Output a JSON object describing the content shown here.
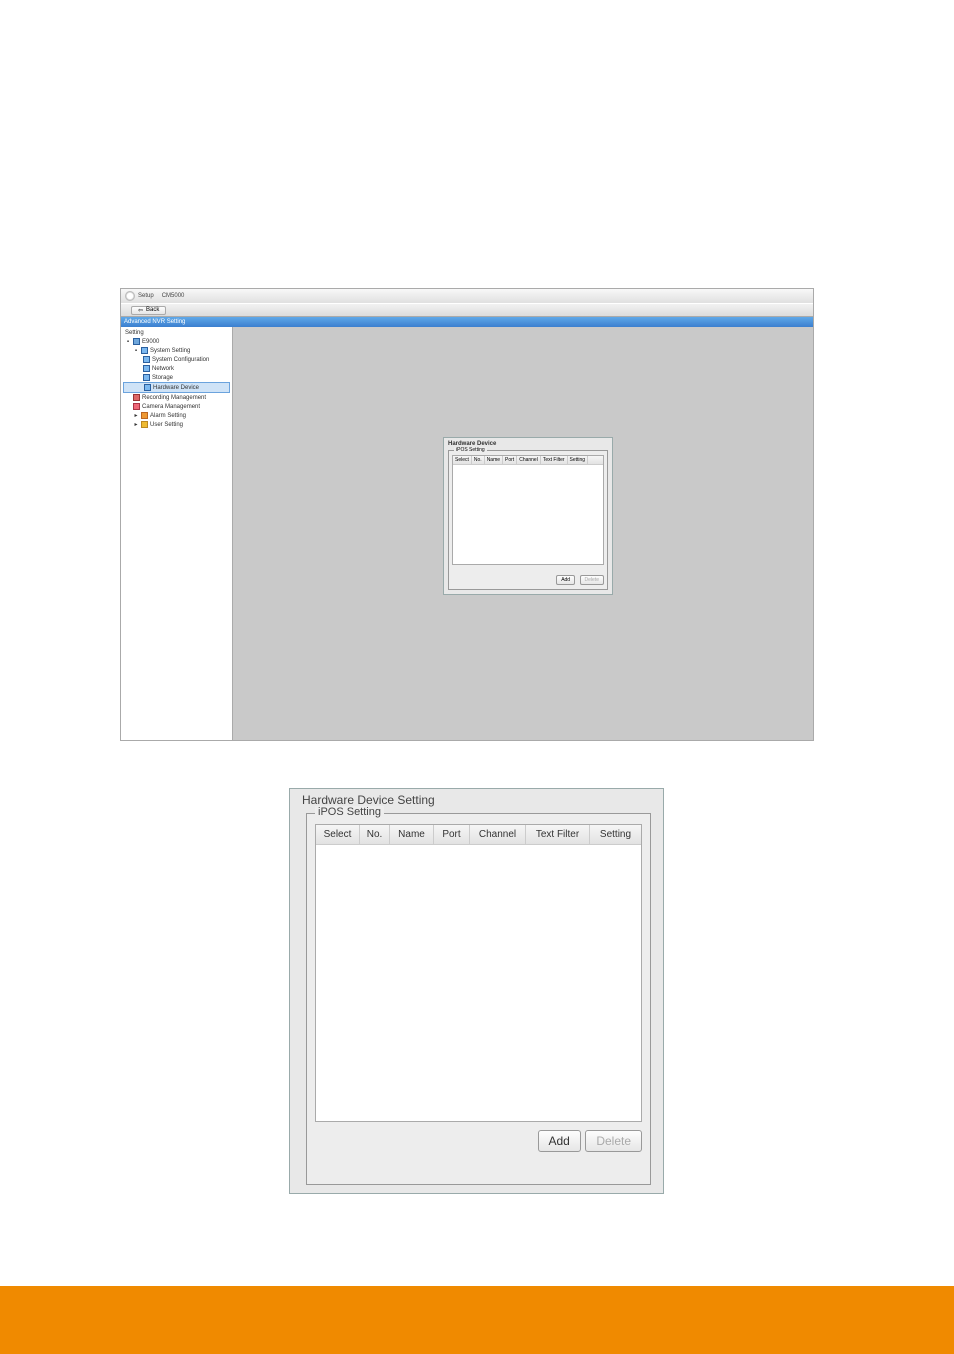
{
  "app": {
    "title": "CM5000",
    "setup_label": "Setup"
  },
  "toolbar": {
    "back_label": "Back"
  },
  "nav_header": "Advanced NVR Setting",
  "tree": {
    "root": "Setting",
    "server": "E9000",
    "system_setting": "System Setting",
    "system_config": "System Configuration",
    "network": "Network",
    "storage": "Storage",
    "hardware_device": "Hardware Device",
    "recording_mgmt": "Recording Management",
    "camera_mgmt": "Camera Management",
    "alarm_setting": "Alarm Setting",
    "user_setting": "User Setting"
  },
  "hw_panel_small": {
    "title": "Hardware Device",
    "legend": "iPOS Setting",
    "cols": {
      "select": "Select",
      "no": "No.",
      "name": "Name",
      "port": "Port",
      "channel": "Channel",
      "tf": "Text Filter",
      "setting": "Setting"
    },
    "add": "Add",
    "delete": "Delete"
  },
  "hw_panel_large": {
    "title": "Hardware Device Setting",
    "legend": "iPOS Setting",
    "cols": {
      "select": "Select",
      "no": "No.",
      "name": "Name",
      "port": "Port",
      "channel": "Channel",
      "tf": "Text Filter",
      "setting": "Setting"
    },
    "add": "Add",
    "delete": "Delete"
  }
}
